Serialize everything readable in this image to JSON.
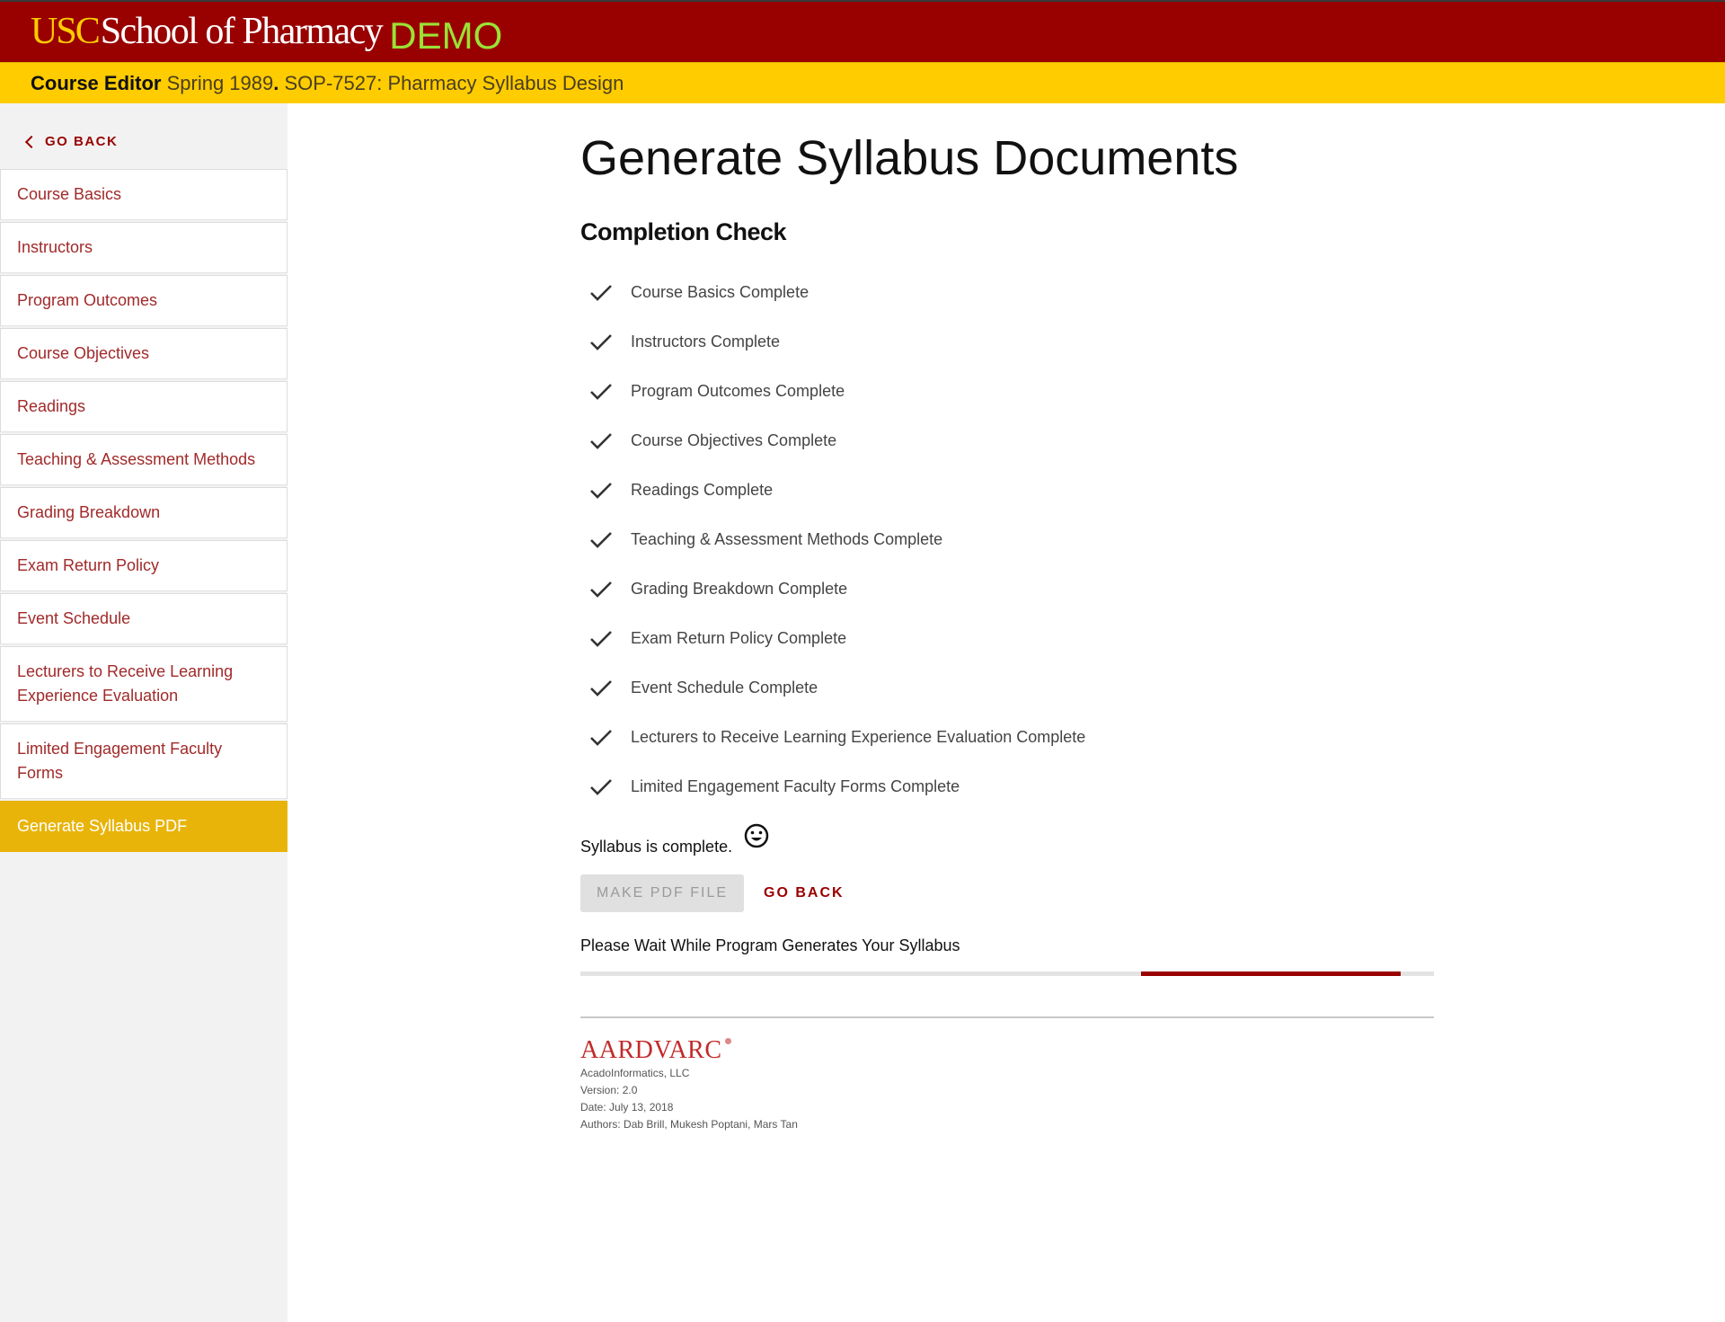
{
  "header": {
    "logo_usc": "USC",
    "logo_school": "School of Pharmacy",
    "logo_demo": "DEMO",
    "colors": {
      "header_bg": "#990000",
      "subbar_bg": "#ffcc00",
      "usc_gold": "#ffcc00",
      "demo_green": "#9be235"
    }
  },
  "subbar": {
    "label": "Course Editor",
    "course": "Spring 1989",
    "separator": ".",
    "course_code": "SOP-7527: Pharmacy Syllabus Design"
  },
  "sidebar": {
    "go_back_label": "GO BACK",
    "items": [
      {
        "label": "Course Basics",
        "active": false
      },
      {
        "label": "Instructors",
        "active": false
      },
      {
        "label": "Program Outcomes",
        "active": false
      },
      {
        "label": "Course Objectives",
        "active": false
      },
      {
        "label": "Readings",
        "active": false
      },
      {
        "label": "Teaching & Assessment Methods",
        "active": false
      },
      {
        "label": "Grading Breakdown",
        "active": false
      },
      {
        "label": "Exam Return Policy",
        "active": false
      },
      {
        "label": "Event Schedule",
        "active": false
      },
      {
        "label": "Lecturers to Receive Learning Experience Evaluation",
        "active": false
      },
      {
        "label": "Limited Engagement Faculty Forms",
        "active": false
      },
      {
        "label": "Generate Syllabus PDF",
        "active": true
      }
    ]
  },
  "main": {
    "title": "Generate Syllabus Documents",
    "completion_title": "Completion Check",
    "checks": [
      {
        "icon": "check-icon",
        "label": "Course Basics Complete"
      },
      {
        "icon": "check-icon",
        "label": "Instructors Complete"
      },
      {
        "icon": "check-icon",
        "label": "Program Outcomes Complete"
      },
      {
        "icon": "check-icon",
        "label": "Course Objectives Complete"
      },
      {
        "icon": "check-icon",
        "label": "Readings Complete"
      },
      {
        "icon": "check-icon",
        "label": "Teaching & Assessment Methods Complete"
      },
      {
        "icon": "check-icon",
        "label": "Grading Breakdown Complete"
      },
      {
        "icon": "check-icon",
        "label": "Exam Return Policy Complete"
      },
      {
        "icon": "check-icon",
        "label": "Event Schedule Complete"
      },
      {
        "icon": "check-icon",
        "label": "Lecturers to Receive Learning Experience Evaluation Complete"
      },
      {
        "icon": "check-icon",
        "label": "Limited Engagement Faculty Forms Complete"
      }
    ],
    "status_text": "Syllabus is complete.",
    "status_icon": "smiley-icon",
    "make_pdf_label": "MAKE PDF FILE",
    "make_pdf_disabled": true,
    "go_back_label": "GO BACK",
    "wait_text": "Please Wait While Program Generates Your Syllabus",
    "progress": {
      "indeterminate": true,
      "segment_start": 0.657,
      "segment_end": 0.961,
      "color": "#990000"
    }
  },
  "footer": {
    "brand": "AARDVARC",
    "company": "AcadoInformatics, LLC",
    "version": "Version: 2.0",
    "date": "Date: July 13, 2018",
    "authors": "Authors: Dab Brill, Mukesh Poptani, Mars Tan"
  }
}
